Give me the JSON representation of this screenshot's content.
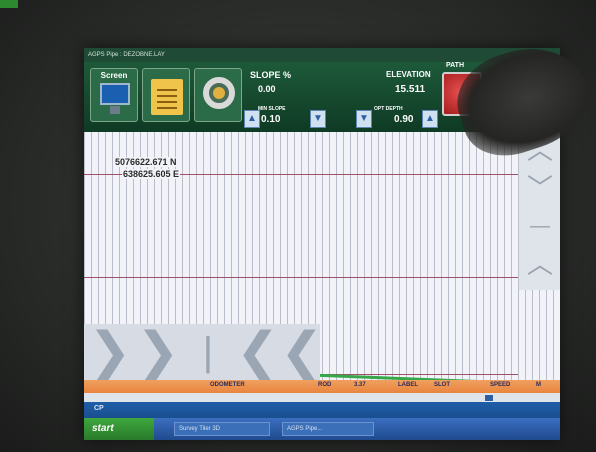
{
  "title_bar": {
    "text": "AGPS Pipe : DEZOBNE.LAY"
  },
  "toolbar": {
    "screen_label": "Screen",
    "doc_label": "",
    "slope_label": "SLOPE %",
    "slope_value": "0.00",
    "min_slope_label": "MIN SLOPE",
    "min_slope_value": "0.10",
    "elevation_label": "ELEVATION",
    "elevation_value": "15.511",
    "opt_depth_label": "OPT DEPTH",
    "opt_depth_value": "0.90",
    "path_label": "PATH",
    "arrow_up": "▲",
    "arrow_down": "▼"
  },
  "map": {
    "northing": "5076622.671 N",
    "easting": "638625.605 E"
  },
  "nav": {
    "chev_up": "︿",
    "chev_down": "﹀",
    "bar": "—",
    "chev_up2": "︿"
  },
  "pan": {
    "right1": "❯",
    "right2": "❯",
    "bar": "|",
    "left1": "❮",
    "left2": "❮"
  },
  "status": {
    "odometer": "ODOMETER",
    "rod": "ROD",
    "val337": "3.37",
    "label": "LABEL",
    "slot": "SLOT",
    "speed": "SPEED",
    "m": "M"
  },
  "bottom": {
    "cp": "CP"
  },
  "taskbar": {
    "start": "start",
    "task1": "Survey Tiler 3D",
    "task2": "AGPS Pipe..."
  },
  "colors": {
    "toolbar": "#1d5a3a",
    "grid_line": "#a05068",
    "grade_line": "#36a84a",
    "status_orange": "#e8843d",
    "taskbar_blue": "#1f4a8e",
    "start_green": "#3ea83e"
  }
}
